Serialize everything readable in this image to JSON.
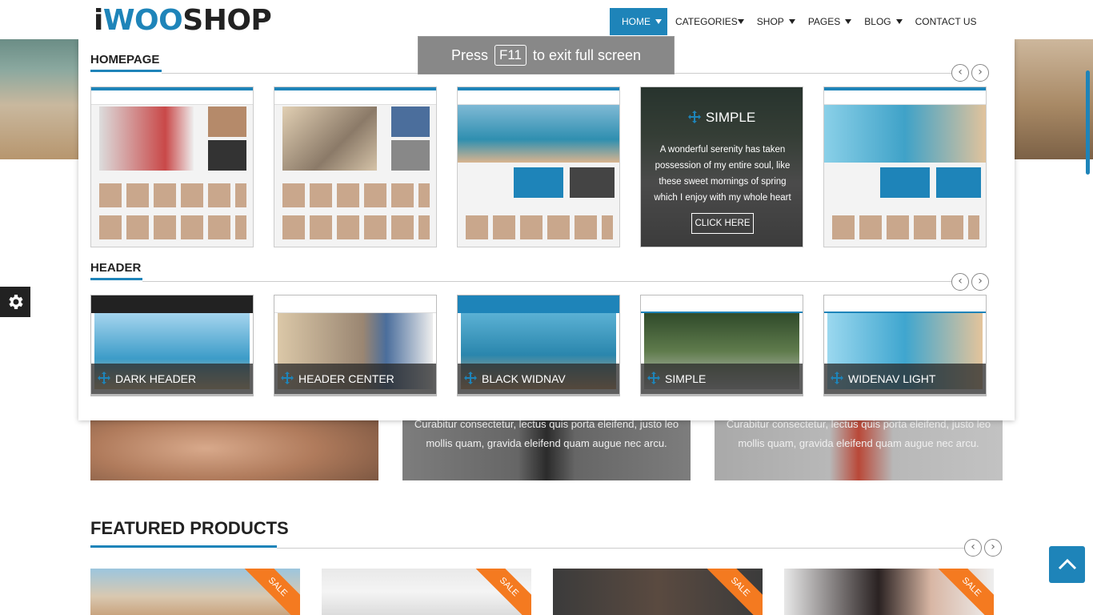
{
  "logo": {
    "i": "i",
    "woo": "WOO",
    "shop": "SHOP"
  },
  "nav": {
    "home": "HOME",
    "categories": "CATEGORIES",
    "shop": "SHOP",
    "pages": "PAGES",
    "blog": "BLOG",
    "contact": "CONTACT US"
  },
  "fullscreen_notice": {
    "before": "Press",
    "key": "F11",
    "after": "to exit full screen"
  },
  "mega_menu": {
    "homepage": {
      "title": "HOMEPAGE",
      "hover": {
        "title": "SIMPLE",
        "text": "A wonderful serenity has taken possession of my entire soul, like these sweet mornings of spring which I enjoy with my whole heart",
        "button": "CLICK HERE"
      }
    },
    "header": {
      "title": "HEADER",
      "items": [
        "DARK HEADER",
        "HEADER CENTER",
        "BLACK WIDNAV",
        "SIMPLE",
        "WIDENAV LIGHT"
      ]
    },
    "arrows": {
      "prev": "‹",
      "next": "›"
    }
  },
  "promos": [
    {
      "text": ""
    },
    {
      "text": "Curabitur consectetur, lectus quis porta eleifend, justo leo mollis quam, gravida eleifend quam augue nec arcu."
    },
    {
      "text": "Curabitur consectetur, lectus quis porta eleifend, justo leo mollis quam, gravida eleifend quam augue nec arcu."
    }
  ],
  "featured": {
    "title": "FEATURED PRODUCTS",
    "sale_label": "SALE"
  },
  "icons": {
    "settings": "gear-icon",
    "back_to_top": "chevron-up-icon",
    "move": "move-icon"
  },
  "colors": {
    "accent": "#1e84b9",
    "sale": "#f47a20",
    "dark": "#222222"
  }
}
